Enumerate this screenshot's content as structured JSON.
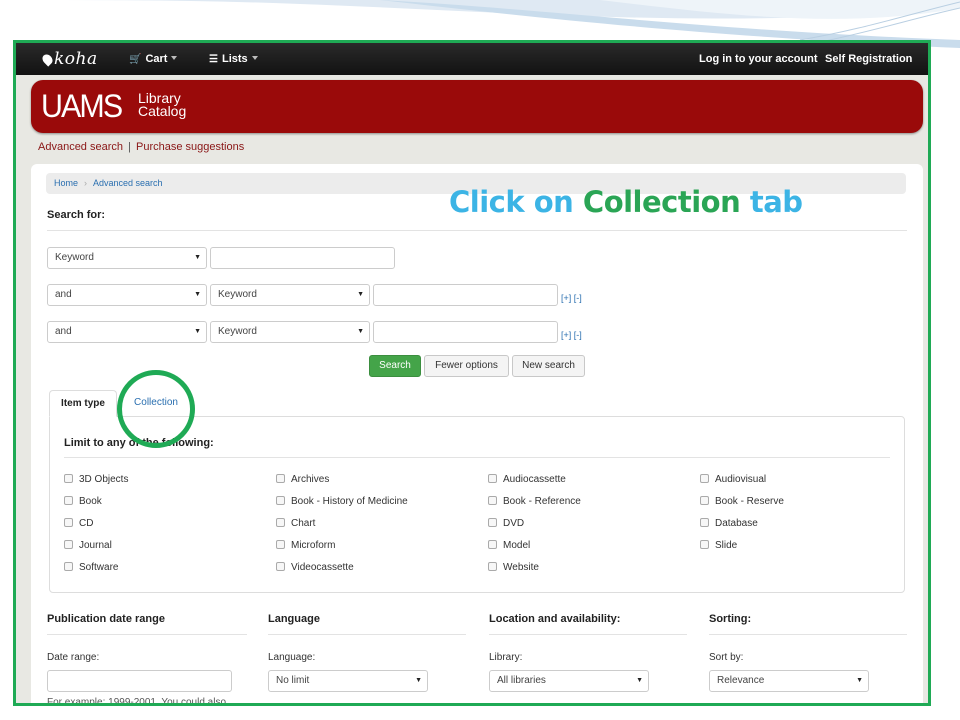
{
  "annotation": {
    "part1": "Click on ",
    "part2": "Collection",
    "part3": " tab"
  },
  "colors": {
    "frame_border": "#1faa55",
    "banner": "#9a0a0a",
    "link": "#2a6fb0",
    "search_button": "#44a449",
    "annotation_blue": "#3cb4e5",
    "annotation_green": "#2aa555"
  },
  "navbar": {
    "logo": "koha",
    "cart": "Cart",
    "lists": "Lists",
    "login": "Log in to your account",
    "self_registration": "Self Registration"
  },
  "banner": {
    "uams": "UAMS",
    "line1": "Library",
    "line2": "Catalog"
  },
  "sublinks": {
    "advanced_search": "Advanced search",
    "separator": "|",
    "purchase_suggestions": "Purchase suggestions"
  },
  "breadcrumb": {
    "home": "Home",
    "current": "Advanced search"
  },
  "search": {
    "heading": "Search for:",
    "rows": [
      {
        "operator": "",
        "index": "Keyword",
        "value": ""
      },
      {
        "operator": "and",
        "index": "Keyword",
        "value": ""
      },
      {
        "operator": "and",
        "index": "Keyword",
        "value": ""
      }
    ],
    "add": "[+]",
    "remove": "[-]",
    "search_button": "Search",
    "fewer_options": "Fewer options",
    "new_search": "New search"
  },
  "tabs": {
    "item_type": "Item type",
    "collection": "Collection"
  },
  "limit": {
    "heading": "Limit to any of the following:",
    "items": [
      "3D Objects",
      "Archives",
      "Audiocassette",
      "Audiovisual",
      "Book",
      "Book - History of Medicine",
      "Book - Reference",
      "Book - Reserve",
      "CD",
      "Chart",
      "DVD",
      "Database",
      "Journal",
      "Microform",
      "Model",
      "Slide",
      "Software",
      "Videocassette",
      "Website"
    ]
  },
  "sections": {
    "pubdate": {
      "title": "Publication date range",
      "label": "Date range:",
      "value": "",
      "example": "For example: 1999-2001. You could also"
    },
    "language": {
      "title": "Language",
      "label": "Language:",
      "value": "No limit"
    },
    "location": {
      "title": "Location and availability:",
      "label": "Library:",
      "value": "All libraries"
    },
    "sorting": {
      "title": "Sorting:",
      "label": "Sort by:",
      "value": "Relevance"
    }
  }
}
